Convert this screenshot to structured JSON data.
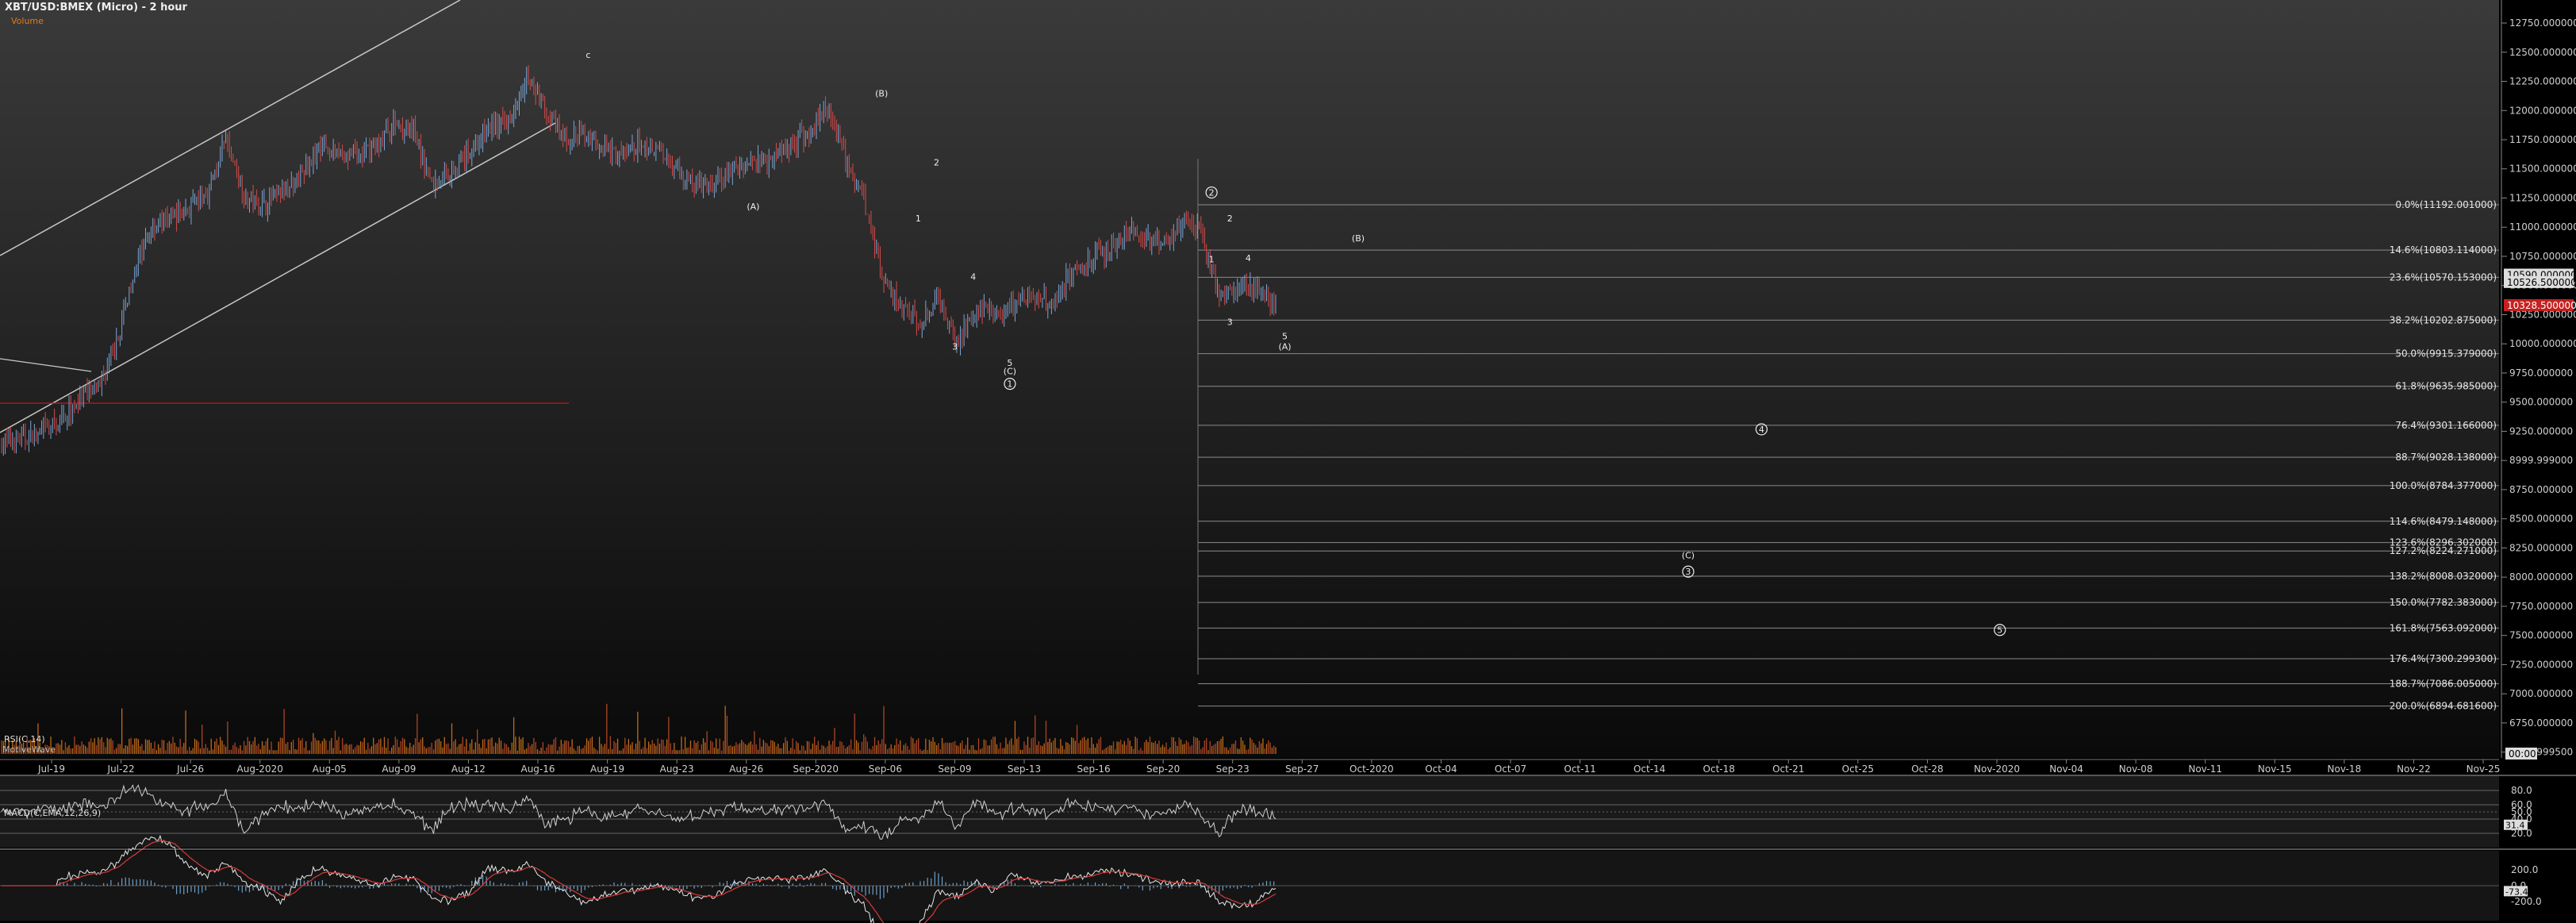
{
  "header": {
    "title": "XBT/USD:BMEX (Micro) - 2 hour",
    "volume_label": "Volume"
  },
  "watermark": "MotiveWave",
  "colors": {
    "background": "#000000",
    "up_candle": "#7aa6d6",
    "down_candle": "#d64a4a",
    "volume": "#e07b1a",
    "channel": "#c8c8c8",
    "grid": "#2a2a2a",
    "fib_line": "#8a8a8a",
    "rsi_line": "#d0d0d0",
    "macd_line": "#e8e8e8",
    "signal_line": "#d63a3a",
    "hist": "#6fa0c8",
    "hline_red": "#b02020"
  },
  "chart_data": {
    "type": "candlestick",
    "price_axis": {
      "ticks": [
        "12750.000000",
        "12500.000000",
        "12250.000000",
        "12000.000000",
        "11750.000000",
        "11500.000000",
        "11250.000000",
        "11000.000000",
        "10750.000000",
        "10500.000000",
        "10250.000000",
        "10000.000000",
        "9750.000000",
        "9500.000000",
        "9250.000000",
        "8999.999000",
        "8750.000000",
        "8500.000000",
        "8250.000000",
        "8000.000000",
        "7750.000000",
        "7500.000000",
        "7250.000000",
        "7000.000000",
        "6750.000000",
        "6499.999500"
      ],
      "ylim": [
        6450,
        12850
      ],
      "current_price": "10328.500000",
      "highlight_price": "10526.500000",
      "other_price": "10590.000000"
    },
    "time_axis": {
      "labels": [
        "Jul-19",
        "Jul-22",
        "Jul-26",
        "Aug-2020",
        "Aug-05",
        "Aug-09",
        "Aug-12",
        "Aug-16",
        "Aug-19",
        "Aug-23",
        "Aug-26",
        "Sep-2020",
        "Sep-06",
        "Sep-09",
        "Sep-13",
        "Sep-16",
        "Sep-20",
        "Sep-23",
        "Sep-27",
        "Oct-2020",
        "Oct-04",
        "Oct-07",
        "Oct-11",
        "Oct-14",
        "Oct-18",
        "Oct-21",
        "Oct-25",
        "Oct-28",
        "Nov-2020",
        "Nov-04",
        "Nov-08",
        "Nov-11",
        "Nov-15",
        "Nov-18",
        "Nov-22",
        "Nov-25"
      ],
      "corner_label": "00:00"
    },
    "price_path": [
      [
        "Jul-16",
        9150
      ],
      [
        "Jul-19",
        9180
      ],
      [
        "Jul-21",
        9230
      ],
      [
        "Jul-22",
        9320
      ],
      [
        "Jul-24",
        9500
      ],
      [
        "Jul-25",
        9600
      ],
      [
        "Jul-26",
        9900
      ],
      [
        "Jul-27",
        10600
      ],
      [
        "Jul-28",
        11000
      ],
      [
        "Jul-29",
        11100
      ],
      [
        "Jul-30",
        11150
      ],
      [
        "Jul-31",
        11300
      ],
      [
        "Aug-01",
        11750
      ],
      [
        "Aug-02",
        11250
      ],
      [
        "Aug-03",
        11200
      ],
      [
        "Aug-04",
        11300
      ],
      [
        "Aug-05",
        11450
      ],
      [
        "Aug-06",
        11700
      ],
      [
        "Aug-07",
        11650
      ],
      [
        "Aug-08",
        11600
      ],
      [
        "Aug-09",
        11700
      ],
      [
        "Aug-10",
        11900
      ],
      [
        "Aug-11",
        11800
      ],
      [
        "Aug-12",
        11350
      ],
      [
        "Aug-13",
        11500
      ],
      [
        "Aug-14",
        11650
      ],
      [
        "Aug-15",
        11850
      ],
      [
        "Aug-16",
        11900
      ],
      [
        "Aug-17",
        12300
      ],
      [
        "Aug-18",
        12000
      ],
      [
        "Aug-19",
        11750
      ],
      [
        "Aug-20",
        11800
      ],
      [
        "Aug-21",
        11700
      ],
      [
        "Aug-22",
        11600
      ],
      [
        "Aug-23",
        11700
      ],
      [
        "Aug-24",
        11700
      ],
      [
        "Aug-25",
        11500
      ],
      [
        "Aug-26",
        11350
      ],
      [
        "Aug-27",
        11350
      ],
      [
        "Aug-28",
        11500
      ],
      [
        "Aug-29",
        11550
      ],
      [
        "Aug-30",
        11600
      ],
      [
        "Aug-31",
        11700
      ],
      [
        "Sep-01",
        11800
      ],
      [
        "Sep-02",
        12050
      ],
      [
        "Sep-03",
        11600
      ],
      [
        "Sep-04",
        11250
      ],
      [
        "Sep-05",
        10600
      ],
      [
        "Sep-06",
        10300
      ],
      [
        "Sep-07",
        10200
      ],
      [
        "Sep-08",
        10400
      ],
      [
        "Sep-09",
        10000
      ],
      [
        "Sep-10",
        10300
      ],
      [
        "Sep-11",
        10250
      ],
      [
        "Sep-12",
        10350
      ],
      [
        "Sep-13",
        10400
      ],
      [
        "Sep-14",
        10350
      ],
      [
        "Sep-15",
        10600
      ],
      [
        "Sep-16",
        10700
      ],
      [
        "Sep-17",
        10800
      ],
      [
        "Sep-18",
        10950
      ],
      [
        "Sep-19",
        10900
      ],
      [
        "Sep-20",
        10850
      ],
      [
        "Sep-21",
        11050
      ],
      [
        "Sep-22",
        10950
      ],
      [
        "Sep-22",
        10400
      ],
      [
        "Sep-23",
        10500
      ],
      [
        "Sep-23",
        10450
      ],
      [
        "Sep-24",
        10330
      ]
    ],
    "fib_levels": [
      {
        "label": "0.0%(11192.001000)",
        "value": 11192.001
      },
      {
        "label": "14.6%(10803.114000)",
        "value": 10803.114
      },
      {
        "label": "23.6%(10570.153000)",
        "value": 10570.153
      },
      {
        "label": "38.2%(10202.875000)",
        "value": 10202.875
      },
      {
        "label": "50.0%(9915.379000)",
        "value": 9915.379
      },
      {
        "label": "61.8%(9635.985000)",
        "value": 9635.985
      },
      {
        "label": "76.4%(9301.166000)",
        "value": 9301.166
      },
      {
        "label": "88.7%(9028.138000)",
        "value": 9028.138
      },
      {
        "label": "100.0%(8784.377000)",
        "value": 8784.377
      },
      {
        "label": "114.6%(8479.148000)",
        "value": 8479.148
      },
      {
        "label": "123.6%(8296.302000)",
        "value": 8296.302
      },
      {
        "label": "127.2%(8224.271000)",
        "value": 8224.271
      },
      {
        "label": "138.2%(8008.032000)",
        "value": 8008.032
      },
      {
        "label": "150.0%(7782.383000)",
        "value": 7782.383
      },
      {
        "label": "161.8%(7563.092000)",
        "value": 7563.092
      },
      {
        "label": "176.4%(7300.299300)",
        "value": 7300.2993
      },
      {
        "label": "188.7%(7086.005000)",
        "value": 7086.005
      },
      {
        "label": "200.0%(6894.681600)",
        "value": 6894.6816
      }
    ],
    "wave_labels": [
      {
        "text": "c",
        "t": "Aug-17",
        "price": 12450,
        "circled": false
      },
      {
        "text": "(B)",
        "t": "Sep-02",
        "price": 12120,
        "circled": false
      },
      {
        "text": "(A)",
        "t": "Aug-26",
        "price": 11150,
        "circled": false
      },
      {
        "text": "1",
        "t": "Sep-04",
        "price": 11050,
        "circled": false
      },
      {
        "text": "2",
        "t": "Sep-05",
        "price": 11530,
        "circled": false
      },
      {
        "text": "3",
        "t": "Sep-06",
        "price": 9950,
        "circled": false
      },
      {
        "text": "4",
        "t": "Sep-07",
        "price": 10550,
        "circled": false
      },
      {
        "text": "5",
        "t": "Sep-09",
        "price": 9810,
        "circled": false
      },
      {
        "text": "(C)",
        "t": "Sep-09",
        "price": 9740,
        "circled": false
      },
      {
        "text": "1",
        "t": "Sep-09",
        "price": 9630,
        "circled": true
      },
      {
        "text": "2",
        "t": "Sep-20",
        "price": 11270,
        "circled": true
      },
      {
        "text": "2",
        "t": "Sep-21",
        "price": 11050,
        "circled": false
      },
      {
        "text": "1",
        "t": "Sep-20",
        "price": 10700,
        "circled": false
      },
      {
        "text": "4",
        "t": "Sep-22",
        "price": 10710,
        "circled": false
      },
      {
        "text": "3",
        "t": "Sep-21",
        "price": 10160,
        "circled": false
      },
      {
        "text": "5",
        "t": "Sep-24",
        "price": 10040,
        "circled": false
      },
      {
        "text": "(A)",
        "t": "Sep-24",
        "price": 9950,
        "circled": false
      },
      {
        "text": "(B)",
        "t": "Sep-28",
        "price": 10880,
        "circled": false
      },
      {
        "text": "4",
        "t": "Oct-20",
        "price": 9240,
        "circled": true
      },
      {
        "text": "(C)",
        "t": "Oct-16",
        "price": 8160,
        "circled": false
      },
      {
        "text": "3",
        "t": "Oct-16",
        "price": 8020,
        "circled": true
      },
      {
        "text": "5",
        "t": "Nov-02",
        "price": 7520,
        "circled": true
      }
    ],
    "rsi": {
      "label": "RSI(C,14)",
      "ticks": [
        "80.0",
        "60.0",
        "50.0",
        "40.0",
        "20.0"
      ],
      "current": "31.4"
    },
    "macd": {
      "label": "MACD(C,EMA,12,26,9)",
      "ticks": [
        "200.0",
        "0.0",
        "-200.0"
      ],
      "current": "-73.4"
    }
  }
}
